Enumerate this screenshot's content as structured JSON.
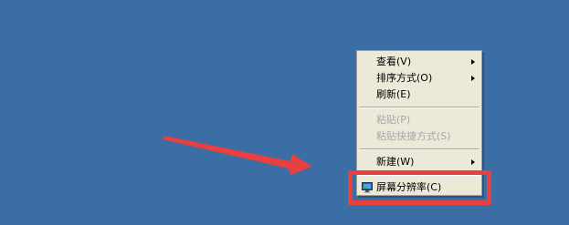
{
  "colors": {
    "desktop_background": "#3a6ea5",
    "menu_background": "#ece9d8",
    "annotation_red": "#e8403f",
    "disabled_text": "#a7a6aa"
  },
  "context_menu": {
    "items": [
      {
        "label": "查看(V)",
        "has_submenu": true,
        "disabled": false
      },
      {
        "label": "排序方式(O)",
        "has_submenu": true,
        "disabled": false
      },
      {
        "label": "刷新(E)",
        "has_submenu": false,
        "disabled": false
      },
      {
        "label": "粘贴(P)",
        "has_submenu": false,
        "disabled": true
      },
      {
        "label": "粘贴快捷方式(S)",
        "has_submenu": false,
        "disabled": true
      },
      {
        "label": "新建(W)",
        "has_submenu": true,
        "disabled": false
      },
      {
        "label": "屏幕分辨率(C)",
        "has_submenu": false,
        "disabled": false,
        "icon": "display-icon"
      }
    ]
  },
  "annotations": {
    "arrow": "red-arrow-pointing-right",
    "highlight": "red-rectangle-around-screen-resolution"
  }
}
